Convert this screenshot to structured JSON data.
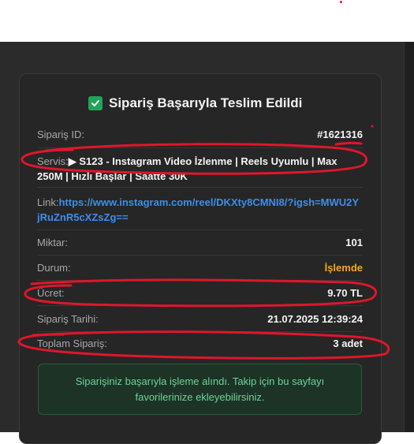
{
  "colors": {
    "background_top": "#ffffff",
    "background_dark": "#2b2b2b",
    "card": "#262626",
    "success_green": "#22a35a",
    "link_blue": "#3d8fe8",
    "status_orange": "#f5a623",
    "notice_text": "#6dd39a",
    "annotation_red": "#e0162b"
  },
  "header": {
    "icon": "check-square-icon",
    "title": "Sipariş Başarıyla Teslim Edildi"
  },
  "order": {
    "id_label": "Sipariş ID:",
    "id_value": "#1621316",
    "service_label": "Servis:",
    "service_value": "▶ S123 - Instagram Video İzlenme | Reels Uyumlu | Max 250M | Hızlı Başlar | Saatte 30K",
    "link_label": "Link:",
    "link_value": "https://www.instagram.com/reel/DKXty8CMNI8/?igsh=MWU2YjRuZnR5cXZsZg==",
    "quantity_label": "Miktar:",
    "quantity_value": "101",
    "status_label": "Durum:",
    "status_value": "İşlemde",
    "price_label": "Ücret:",
    "price_value": "9.70 TL",
    "date_label": "Sipariş Tarihi:",
    "date_value": "21.07.2025 12:39:24",
    "total_label": "Toplam Sipariş:",
    "total_value": "3 adet"
  },
  "notice": {
    "text": "Siparişiniz başarıyla işleme alındı. Takip için bu sayfayı favorilerinize ekleyebilirsiniz."
  }
}
